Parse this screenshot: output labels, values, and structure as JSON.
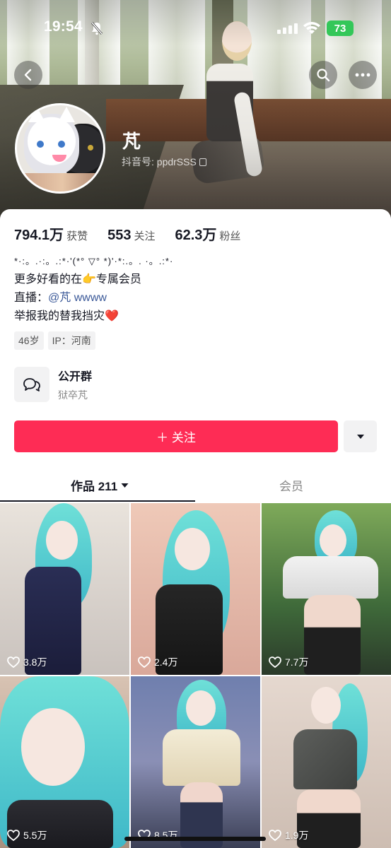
{
  "status_bar": {
    "time": "19:54",
    "battery": "73"
  },
  "profile": {
    "name": "芃",
    "douyin_id": "抖音号: ppdrSSS",
    "stats": [
      {
        "value": "794.1万",
        "label": "获赞"
      },
      {
        "value": "553",
        "label": "关注"
      },
      {
        "value": "62.3万",
        "label": "粉丝"
      }
    ],
    "bio": {
      "line1": "*·:。.·:。.:*·'(*° ▽° *)'·*:.。. ·。.:*·",
      "line2": "更多好看的在👉专属会员",
      "line3_prefix": "直播：",
      "line3_link": "@芃 wwww",
      "line4": "举报我的替我挡灾❤️"
    },
    "tags": [
      "46岁",
      "IP：河南"
    ],
    "group": {
      "title": "公开群",
      "subtitle": "狱卒芃"
    }
  },
  "actions": {
    "follow_label": "＋ 关注"
  },
  "tabs": {
    "works_label": "作品 211",
    "member_label": "会员"
  },
  "videos": [
    {
      "likes": "3.8万"
    },
    {
      "likes": "2.4万"
    },
    {
      "likes": "7.7万"
    },
    {
      "likes": "5.5万"
    },
    {
      "likes": "8.5万"
    },
    {
      "likes": "1.9万"
    }
  ],
  "colors": {
    "accent": "#fe2c55",
    "link": "#3b5998",
    "battery": "#34c759"
  },
  "icons": [
    "back-icon",
    "search-icon",
    "more-icon",
    "copy-icon",
    "group-chat-icon",
    "chevron-down-icon",
    "heart-icon",
    "mute-bell-icon",
    "wifi-icon",
    "signal-icon"
  ]
}
